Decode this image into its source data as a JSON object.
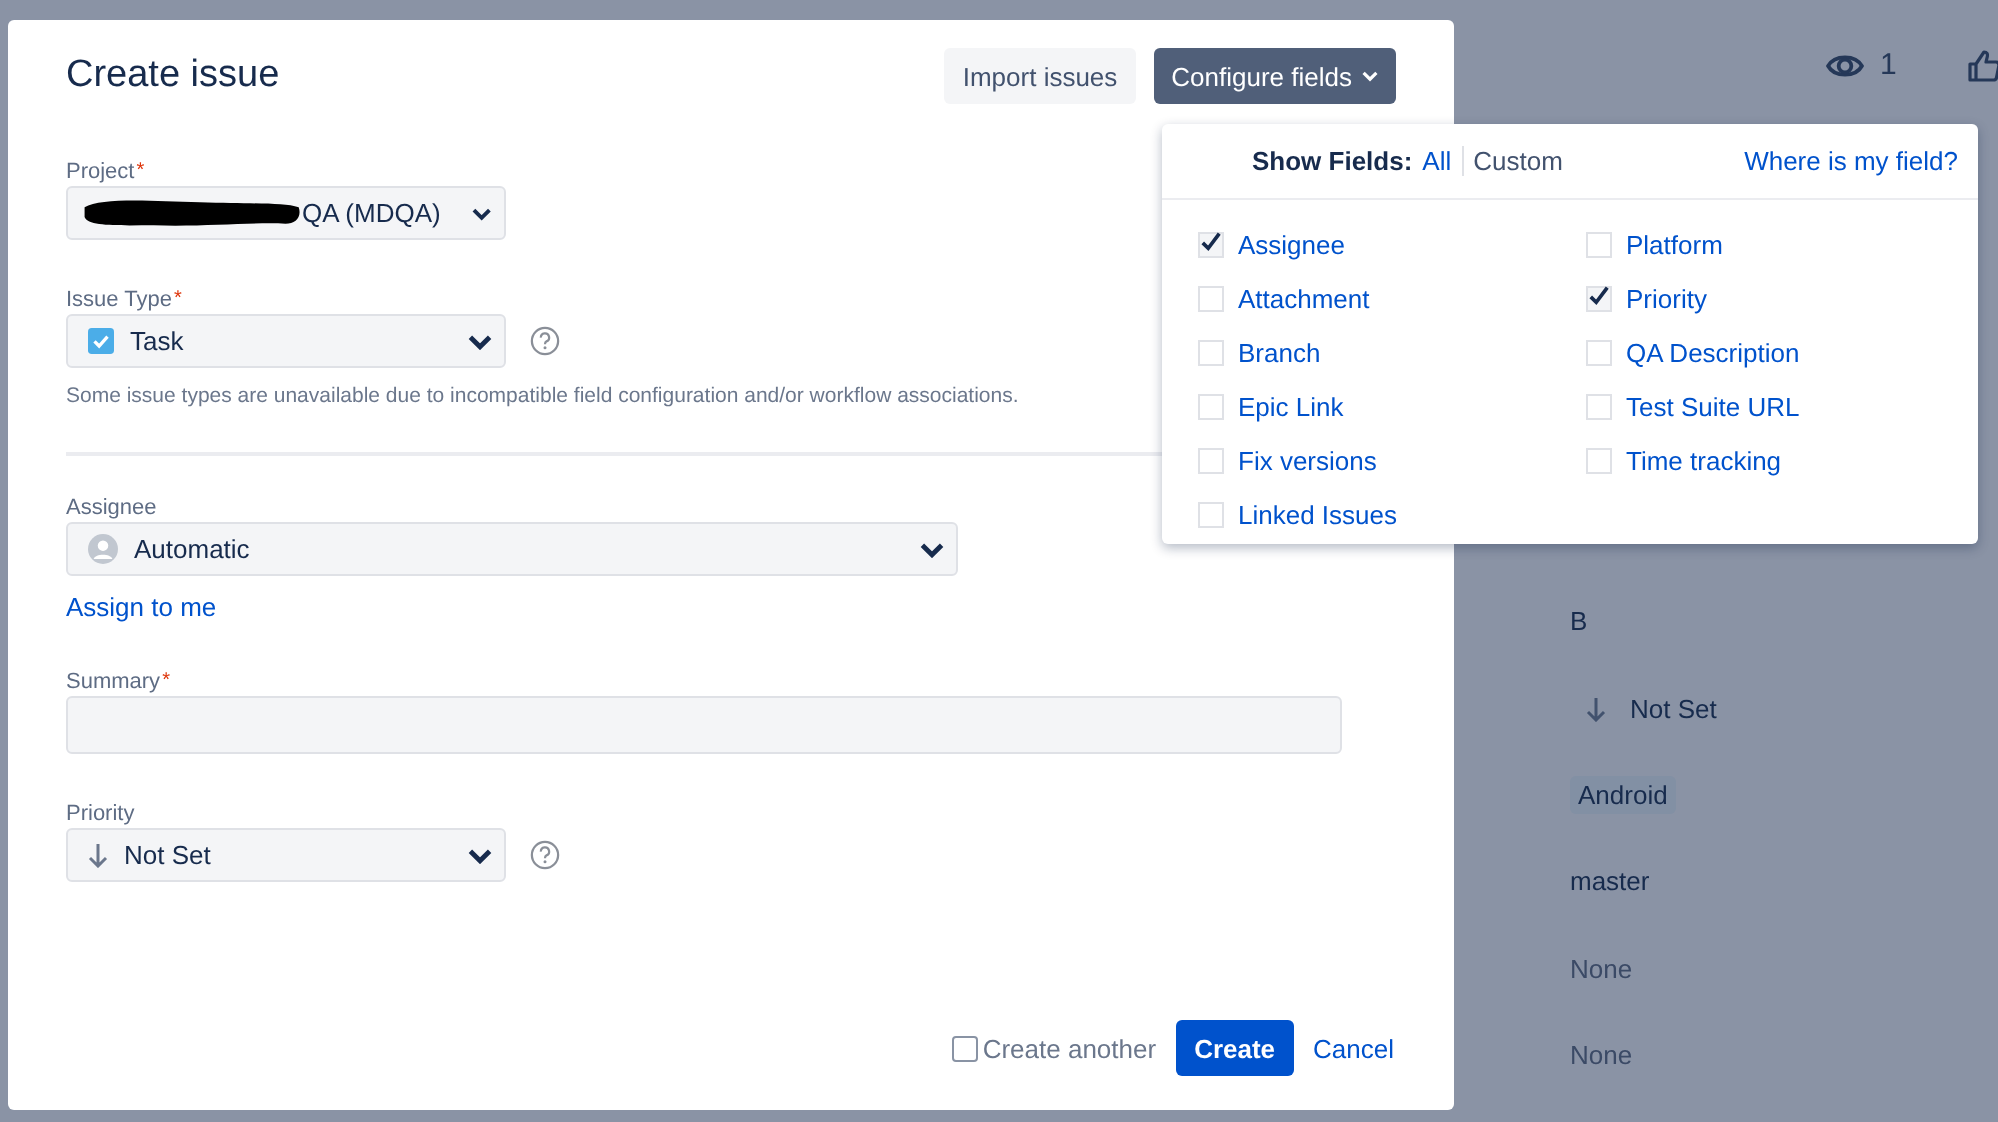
{
  "background": {
    "watchers": "1",
    "values": [
      {
        "kind": "text",
        "text": "B"
      },
      {
        "kind": "priority",
        "text": "Not Set"
      },
      {
        "kind": "tag",
        "text": "Android"
      },
      {
        "kind": "text",
        "text": "master"
      },
      {
        "kind": "muted",
        "text": "None"
      },
      {
        "kind": "muted",
        "text": "None"
      }
    ]
  },
  "dialog": {
    "title": "Create issue",
    "header_buttons": [
      {
        "label": "Import issues",
        "kind": "secondary"
      },
      {
        "label": "Configure fields",
        "kind": "dropdown"
      }
    ],
    "fields": [
      {
        "kind": "select",
        "label": "Project",
        "required_mark": "*",
        "value": "QA (MDQA)",
        "redacted": true
      },
      {
        "kind": "type-select",
        "label": "Issue Type",
        "required_mark": "*",
        "value": "Task",
        "help": true,
        "note": "Some issue types are unavailable due to incompatible field configuration and/or workflow associations."
      },
      {
        "kind": "divider"
      },
      {
        "kind": "user-select",
        "label": "Assignee",
        "value": "Automatic",
        "link": "Assign to me"
      },
      {
        "kind": "text",
        "label": "Summary",
        "required_mark": "*"
      },
      {
        "kind": "priority-select",
        "label": "Priority",
        "value": "Not Set",
        "help": true
      }
    ],
    "create_another": {
      "label": "Create another",
      "checked": false
    },
    "buttons": [
      {
        "label": "Create",
        "kind": "primary"
      },
      {
        "label": "Cancel",
        "kind": "link"
      }
    ]
  },
  "field_menu": {
    "title": "Show Fields:",
    "options": [
      {
        "label": "All",
        "selected": false
      },
      {
        "label": "Custom",
        "selected": true
      }
    ],
    "help_link": "Where is my field?",
    "columns": [
      [
        {
          "label": "Assignee",
          "checked": true
        },
        {
          "label": "Attachment",
          "checked": false
        },
        {
          "label": "Branch",
          "checked": false
        },
        {
          "label": "Epic Link",
          "checked": false
        },
        {
          "label": "Fix versions",
          "checked": false
        },
        {
          "label": "Linked Issues",
          "checked": false
        }
      ],
      [
        {
          "label": "Platform",
          "checked": false
        },
        {
          "label": "Priority",
          "checked": true
        },
        {
          "label": "QA Description",
          "checked": false
        },
        {
          "label": "Test Suite URL",
          "checked": false
        },
        {
          "label": "Time tracking",
          "checked": false
        }
      ]
    ]
  }
}
